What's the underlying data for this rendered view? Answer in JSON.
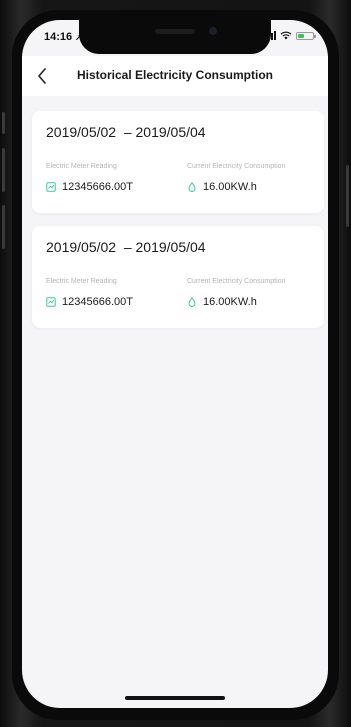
{
  "status_bar": {
    "time": "14:16",
    "battery_level": 0.5,
    "battery_color": "#3cc35b"
  },
  "header": {
    "title": "Historical Electricity Consumption",
    "back_icon": "chevron-left-icon"
  },
  "records": [
    {
      "range": "2019/05/02  – 2019/05/04",
      "meter_label": "Electric Meter Reading",
      "meter_value": "12345666.00T",
      "consumption_label": "Current Electricity Consumption",
      "consumption_value": "16.00KW.h"
    },
    {
      "range": "2019/05/02  – 2019/05/04",
      "meter_label": "Electric Meter Reading",
      "meter_value": "12345666.00T",
      "consumption_label": "Current Electricity Consumption",
      "consumption_value": "16.00KW.h"
    }
  ],
  "colors": {
    "accent": "#3cc9a4",
    "background": "#f5f5f7"
  }
}
